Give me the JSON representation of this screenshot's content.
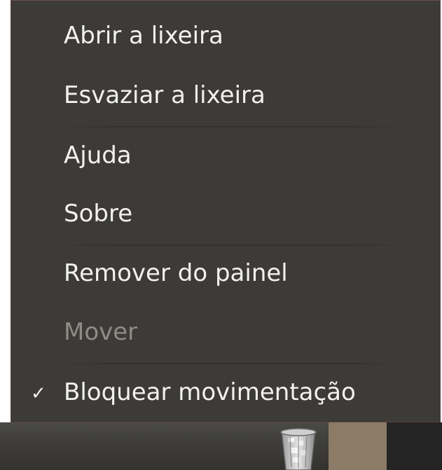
{
  "menu": {
    "items": [
      {
        "label": "Abrir a lixeira",
        "enabled": true
      },
      {
        "label": "Esvaziar a lixeira",
        "enabled": true
      },
      {
        "label": "Ajuda",
        "enabled": true
      },
      {
        "label": "Sobre",
        "enabled": true
      },
      {
        "label": "Remover do painel",
        "enabled": true
      },
      {
        "label": "Mover",
        "enabled": false
      },
      {
        "label": "Bloquear movimentação",
        "enabled": true,
        "checked": true
      }
    ],
    "check_glyph": "✓"
  },
  "panel": {
    "trash_icon": "trash-can-icon"
  },
  "colors": {
    "menu_bg": "#3c3b37",
    "menu_text": "#f2f1f0",
    "disabled_text": "#8e8c86",
    "panel_bg": "#3e3d3a",
    "panel_accent": "#8b7b67"
  }
}
